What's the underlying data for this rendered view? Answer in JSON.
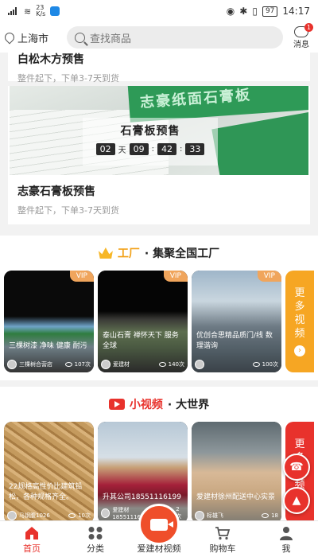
{
  "status_bar": {
    "net_speed": "23\nK/s",
    "battery": "97",
    "time": "14:17"
  },
  "header": {
    "location": "上海市",
    "search_placeholder": "查找商品",
    "message_label": "消息",
    "message_count": "1"
  },
  "presales": [
    {
      "title": "白松木方预售",
      "subtitle": "整件起下，下单3-7天到货"
    },
    {
      "title": "志豪石膏板预售",
      "subtitle": "整件起下，下单3-7天到货",
      "banner_title": "石膏板预售",
      "countdown": {
        "days": "02",
        "day_unit": "天",
        "hours": "09",
        "minutes": "42",
        "seconds": "33"
      }
    }
  ],
  "factory_section": {
    "title_a": "工厂",
    "title_b": "· 集聚全国工厂",
    "tiles": [
      {
        "vip": "VIP",
        "caption": "三棵树漆 净味 健康 耐污",
        "author": "三棵树合营店",
        "views": "107次"
      },
      {
        "vip": "VIP",
        "caption": "泰山石膏 禅怀天下 服务全球",
        "author": "爱建材",
        "views": "140次"
      },
      {
        "vip": "VIP",
        "caption": "优创合思精品质门/线 数理谐询",
        "author": "",
        "views": "100次"
      }
    ],
    "more": [
      "更",
      "多",
      "视",
      "频"
    ]
  },
  "video_section": {
    "title_a": "小视频",
    "title_b": "· 大世界",
    "tiles": [
      {
        "caption": "22规格高性价比建筑铅松，各种规格齐全。",
        "author": "马钢腹1026",
        "views": "10次"
      },
      {
        "caption": "升其公司18551116199",
        "author": "爱建材18551116199",
        "views": "2次"
      },
      {
        "caption": "爱建材徐州配送中心实景",
        "author": "标雄飞",
        "views": "18"
      }
    ],
    "more": [
      "更",
      "多",
      "视",
      "频"
    ]
  },
  "tabs": [
    {
      "label": "首页",
      "icon": "home-icon"
    },
    {
      "label": "分类",
      "icon": "grid-icon"
    },
    {
      "label": "爱建材视频",
      "icon": "video-camera-icon"
    },
    {
      "label": "购物车",
      "icon": "cart-icon"
    },
    {
      "label": "我",
      "icon": "user-icon"
    }
  ],
  "colors": {
    "accent": "#e8322c",
    "gold": "#f2a21a",
    "tab_center": "#ef4e2a"
  }
}
